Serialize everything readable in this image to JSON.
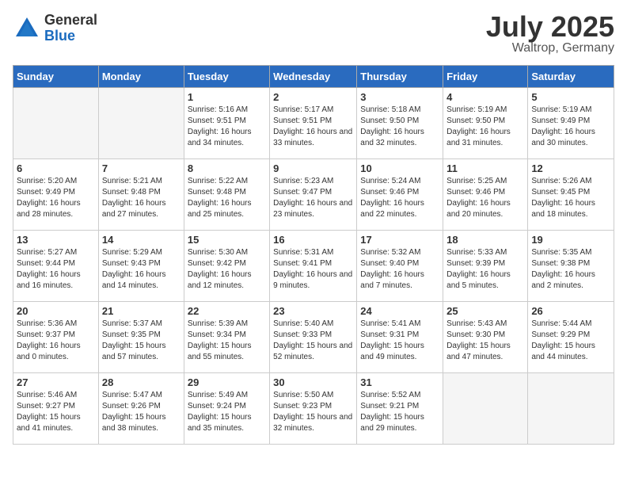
{
  "logo": {
    "general": "General",
    "blue": "Blue"
  },
  "title": {
    "month": "July 2025",
    "location": "Waltrop, Germany"
  },
  "weekdays": [
    "Sunday",
    "Monday",
    "Tuesday",
    "Wednesday",
    "Thursday",
    "Friday",
    "Saturday"
  ],
  "weeks": [
    [
      {
        "day": "",
        "info": ""
      },
      {
        "day": "",
        "info": ""
      },
      {
        "day": "1",
        "info": "Sunrise: 5:16 AM\nSunset: 9:51 PM\nDaylight: 16 hours and 34 minutes."
      },
      {
        "day": "2",
        "info": "Sunrise: 5:17 AM\nSunset: 9:51 PM\nDaylight: 16 hours and 33 minutes."
      },
      {
        "day": "3",
        "info": "Sunrise: 5:18 AM\nSunset: 9:50 PM\nDaylight: 16 hours and 32 minutes."
      },
      {
        "day": "4",
        "info": "Sunrise: 5:19 AM\nSunset: 9:50 PM\nDaylight: 16 hours and 31 minutes."
      },
      {
        "day": "5",
        "info": "Sunrise: 5:19 AM\nSunset: 9:49 PM\nDaylight: 16 hours and 30 minutes."
      }
    ],
    [
      {
        "day": "6",
        "info": "Sunrise: 5:20 AM\nSunset: 9:49 PM\nDaylight: 16 hours and 28 minutes."
      },
      {
        "day": "7",
        "info": "Sunrise: 5:21 AM\nSunset: 9:48 PM\nDaylight: 16 hours and 27 minutes."
      },
      {
        "day": "8",
        "info": "Sunrise: 5:22 AM\nSunset: 9:48 PM\nDaylight: 16 hours and 25 minutes."
      },
      {
        "day": "9",
        "info": "Sunrise: 5:23 AM\nSunset: 9:47 PM\nDaylight: 16 hours and 23 minutes."
      },
      {
        "day": "10",
        "info": "Sunrise: 5:24 AM\nSunset: 9:46 PM\nDaylight: 16 hours and 22 minutes."
      },
      {
        "day": "11",
        "info": "Sunrise: 5:25 AM\nSunset: 9:46 PM\nDaylight: 16 hours and 20 minutes."
      },
      {
        "day": "12",
        "info": "Sunrise: 5:26 AM\nSunset: 9:45 PM\nDaylight: 16 hours and 18 minutes."
      }
    ],
    [
      {
        "day": "13",
        "info": "Sunrise: 5:27 AM\nSunset: 9:44 PM\nDaylight: 16 hours and 16 minutes."
      },
      {
        "day": "14",
        "info": "Sunrise: 5:29 AM\nSunset: 9:43 PM\nDaylight: 16 hours and 14 minutes."
      },
      {
        "day": "15",
        "info": "Sunrise: 5:30 AM\nSunset: 9:42 PM\nDaylight: 16 hours and 12 minutes."
      },
      {
        "day": "16",
        "info": "Sunrise: 5:31 AM\nSunset: 9:41 PM\nDaylight: 16 hours and 9 minutes."
      },
      {
        "day": "17",
        "info": "Sunrise: 5:32 AM\nSunset: 9:40 PM\nDaylight: 16 hours and 7 minutes."
      },
      {
        "day": "18",
        "info": "Sunrise: 5:33 AM\nSunset: 9:39 PM\nDaylight: 16 hours and 5 minutes."
      },
      {
        "day": "19",
        "info": "Sunrise: 5:35 AM\nSunset: 9:38 PM\nDaylight: 16 hours and 2 minutes."
      }
    ],
    [
      {
        "day": "20",
        "info": "Sunrise: 5:36 AM\nSunset: 9:37 PM\nDaylight: 16 hours and 0 minutes."
      },
      {
        "day": "21",
        "info": "Sunrise: 5:37 AM\nSunset: 9:35 PM\nDaylight: 15 hours and 57 minutes."
      },
      {
        "day": "22",
        "info": "Sunrise: 5:39 AM\nSunset: 9:34 PM\nDaylight: 15 hours and 55 minutes."
      },
      {
        "day": "23",
        "info": "Sunrise: 5:40 AM\nSunset: 9:33 PM\nDaylight: 15 hours and 52 minutes."
      },
      {
        "day": "24",
        "info": "Sunrise: 5:41 AM\nSunset: 9:31 PM\nDaylight: 15 hours and 49 minutes."
      },
      {
        "day": "25",
        "info": "Sunrise: 5:43 AM\nSunset: 9:30 PM\nDaylight: 15 hours and 47 minutes."
      },
      {
        "day": "26",
        "info": "Sunrise: 5:44 AM\nSunset: 9:29 PM\nDaylight: 15 hours and 44 minutes."
      }
    ],
    [
      {
        "day": "27",
        "info": "Sunrise: 5:46 AM\nSunset: 9:27 PM\nDaylight: 15 hours and 41 minutes."
      },
      {
        "day": "28",
        "info": "Sunrise: 5:47 AM\nSunset: 9:26 PM\nDaylight: 15 hours and 38 minutes."
      },
      {
        "day": "29",
        "info": "Sunrise: 5:49 AM\nSunset: 9:24 PM\nDaylight: 15 hours and 35 minutes."
      },
      {
        "day": "30",
        "info": "Sunrise: 5:50 AM\nSunset: 9:23 PM\nDaylight: 15 hours and 32 minutes."
      },
      {
        "day": "31",
        "info": "Sunrise: 5:52 AM\nSunset: 9:21 PM\nDaylight: 15 hours and 29 minutes."
      },
      {
        "day": "",
        "info": ""
      },
      {
        "day": "",
        "info": ""
      }
    ]
  ]
}
